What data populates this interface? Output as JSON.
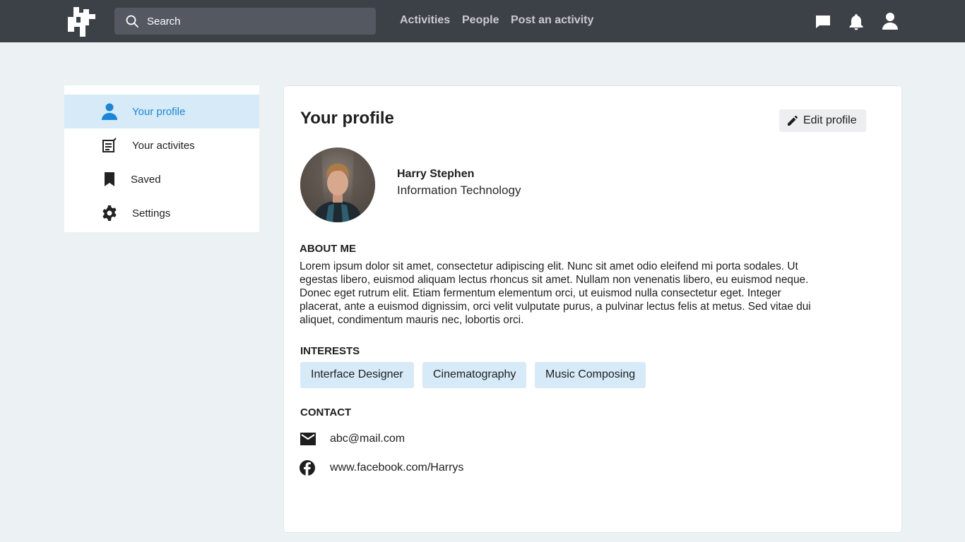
{
  "topbar": {
    "search_placeholder": "Search",
    "nav": [
      "Activities",
      "People",
      "Post an activity"
    ],
    "icons": [
      "chat-icon",
      "bell-icon",
      "user-icon"
    ],
    "background": "#3c4047"
  },
  "sidebar": {
    "items": [
      {
        "label": "Your profile",
        "icon": "person-icon",
        "active": true
      },
      {
        "label": "Your activites",
        "icon": "activity-icon",
        "active": false
      },
      {
        "label": "Saved",
        "icon": "bookmark-icon",
        "active": false
      },
      {
        "label": "Settings",
        "icon": "gear-icon",
        "active": false
      }
    ],
    "active_color": "#1a86d8",
    "active_bg": "#d6eaf8"
  },
  "profile": {
    "title": "Your profile",
    "edit_label": "Edit profile",
    "name": "Harry Stephen",
    "department": "Information Technology",
    "about_heading": "ABOUT ME",
    "about_text": "Lorem ipsum dolor sit amet, consectetur adipiscing elit. Nunc sit amet odio eleifend mi porta sodales. Ut egestas libero, euismod aliquam lectus rhoncus sit amet. Nullam non venenatis libero, eu euismod neque. Donec eget rutrum elit. Etiam fermentum elementum orci, ut euismod nulla consectetur eget. Integer placerat, ante a euismod dignissim, orci velit vulputate purus, a pulvinar lectus felis at metus. Sed vitae dui aliquet, condimentum mauris nec, lobortis orci.",
    "interests_heading": "INTERESTS",
    "interests": [
      "Interface Designer",
      "Cinematography",
      "Music Composing"
    ],
    "contact_heading": "CONTACT",
    "email": "abc@mail.com",
    "facebook": "www.facebook.com/Harrys"
  }
}
